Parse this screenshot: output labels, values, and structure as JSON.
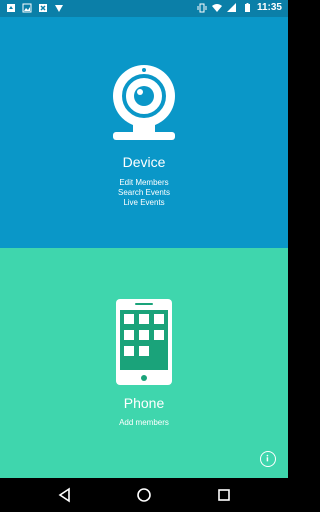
{
  "status_bar": {
    "time": "11:35",
    "left_icons": [
      "notification-icon",
      "image-icon",
      "sync-icon",
      "alert-icon"
    ],
    "right_icons": [
      "vibrate-icon",
      "wifi-icon",
      "signal-icon",
      "battery-icon"
    ]
  },
  "device_panel": {
    "title": "Device",
    "links": [
      "Edit Members",
      "Search Events",
      "Live Events"
    ],
    "icon": "webcam-icon",
    "color": "#0a97c8"
  },
  "phone_panel": {
    "title": "Phone",
    "links": [
      "Add members"
    ],
    "icon": "phone-icon",
    "color": "#3fd6ad"
  },
  "info_button": {
    "icon": "info-icon"
  },
  "nav_bar": {
    "buttons": [
      "back-icon",
      "home-icon",
      "recents-icon"
    ]
  }
}
